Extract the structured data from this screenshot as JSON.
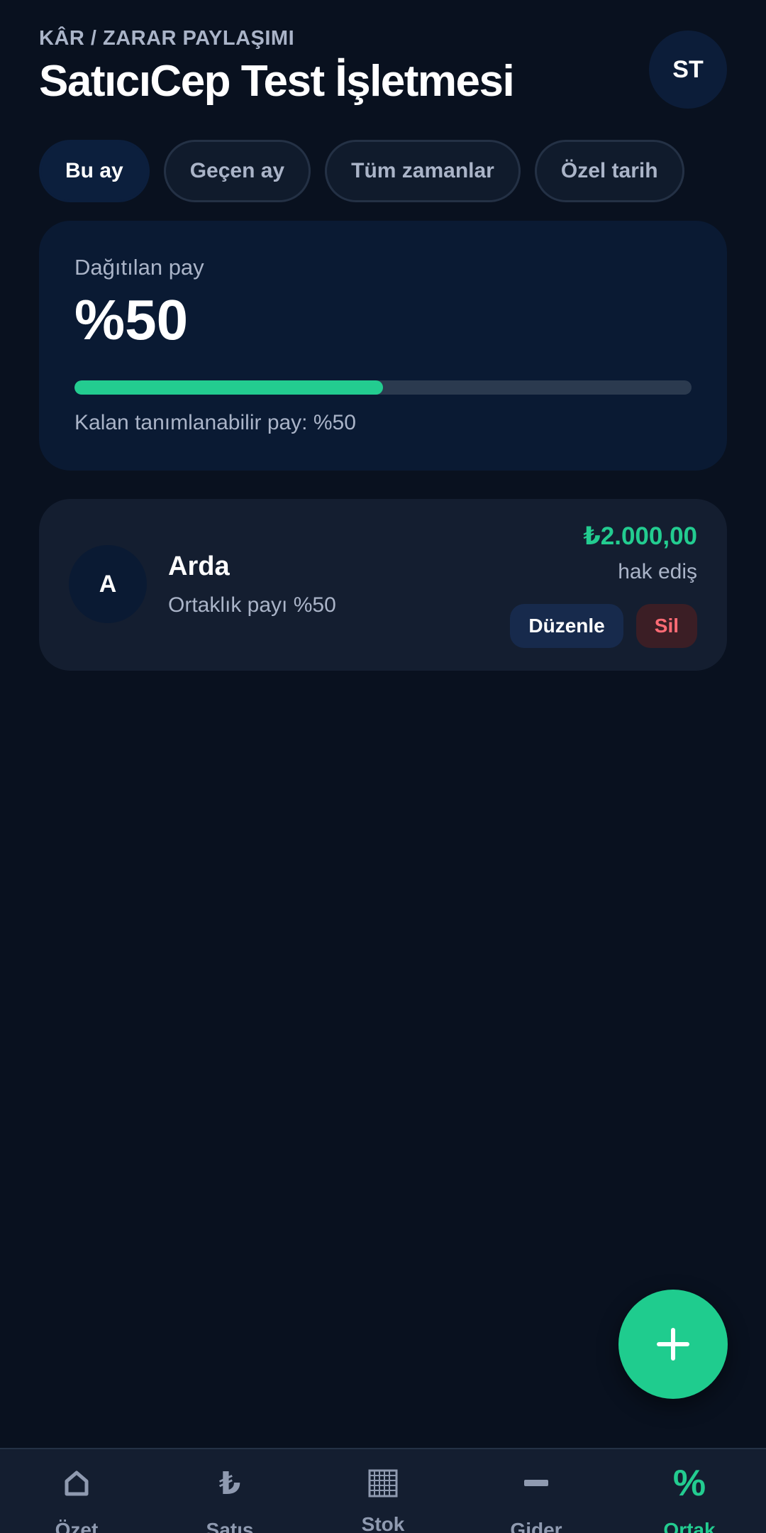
{
  "header": {
    "eyebrow": "KÂR / ZARAR PAYLAŞIMI",
    "title": "SatıcıCep Test İşletmesi",
    "avatar_initials": "ST"
  },
  "filters": [
    {
      "label": "Bu ay",
      "active": true
    },
    {
      "label": "Geçen ay",
      "active": false
    },
    {
      "label": "Tüm zamanlar",
      "active": false
    },
    {
      "label": "Özel tarih",
      "active": false
    }
  ],
  "summary": {
    "label": "Dağıtılan pay",
    "value": "%50",
    "progress_percent": 50,
    "remaining_text": "Kalan tanımlanabilir pay: %50"
  },
  "partners": [
    {
      "initial": "A",
      "name": "Arda",
      "share_text": "Ortaklık payı %50",
      "amount": "₺2.000,00",
      "amount_label": "hak ediş",
      "edit_label": "Düzenle",
      "delete_label": "Sil"
    }
  ],
  "fab": {
    "icon": "plus-icon"
  },
  "bottom_nav": [
    {
      "label": "Özet",
      "icon": "home-icon",
      "active": false
    },
    {
      "label": "Satış",
      "icon": "lira-icon",
      "active": false
    },
    {
      "label": "Stok",
      "icon": "grid-icon",
      "active": false
    },
    {
      "label": "Gider",
      "icon": "minus-icon",
      "active": false
    },
    {
      "label": "Ortak",
      "icon": "percent-icon",
      "active": true
    }
  ],
  "colors": {
    "background": "#09111f",
    "card": "#141e30",
    "summary_card": "#0a1a33",
    "accent": "#23cc90",
    "danger": "#ff6b75",
    "muted_text": "#aab4c8"
  }
}
